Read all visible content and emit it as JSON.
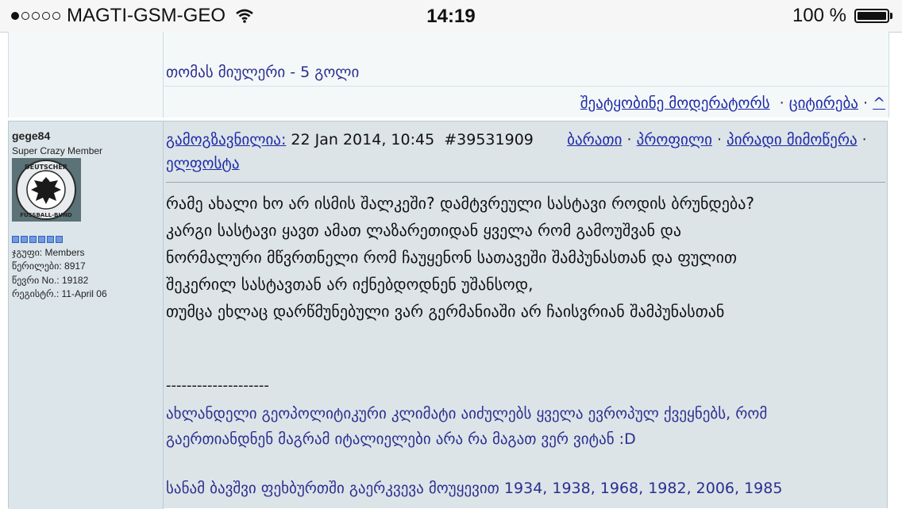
{
  "status_bar": {
    "carrier": "MAGTI-GSM-GEO",
    "signal_bars_filled": 1,
    "signal_bars_total": 5,
    "time": "14:19",
    "battery": "100 %"
  },
  "previous_post": {
    "signature": "თომას მიულერი - 5 გოლი",
    "actions": {
      "report": "შეატყობინე მოდერატორს",
      "quote": "ციტირება",
      "up": "^"
    }
  },
  "post": {
    "author": {
      "username": "gege84",
      "title": "Super Crazy Member",
      "avatar_text": "DEUTSCHER FUSSBALL-BUND",
      "group": "ჯგუფი: Members",
      "posts": "წერილები: 8917",
      "member_no": "წევრი No.: 19182",
      "registered": "რეგისტრ.: 11-April 06"
    },
    "header": {
      "sent_label": "გამოგზავნილია:",
      "datetime": "22 Jan 2014, 10:45",
      "post_id": "#39531909",
      "links": {
        "card": "ბარათი",
        "profile": "პროფილი",
        "private_message": "პირადი მიმოწერა",
        "email": "ელფოსტა"
      }
    },
    "body": [
      "რამე ახალი ხო არ ისმის შალკეში? დამტვრეული სასტავი როდის ბრუნდება?",
      "კარგი სასტავი ყავთ ამათ ლაზარეთიდან ყველა რომ გამოუშვან და",
      "ნორმალური მწვრთნელი რომ ჩაუყენონ სათავეში შამპუნასთან და ფულით",
      "შეკერილ სასტავთან არ იქნებდოდნენ უშანსოდ,",
      "თუმცა ეხლაც დარწმუნებული ვარ გერმანიაში არ ჩაისვრიან შამპუნასთან"
    ],
    "signature_separator": "--------------------",
    "signature": [
      "ახლანდელი გეოპოლიტიკური კლიმატი აიძულებს ყველა ევროპულ ქვეყნებს, რომ",
      "გაერთიანდნენ მაგრამ იტალიელები არა რა მაგათ ვერ ვიტან :D",
      "სანამ ბავშვი ფეხბურთში გაერკვევა მოუყევით 1934, 1938, 1968, 1982, 2006, 1985"
    ]
  }
}
